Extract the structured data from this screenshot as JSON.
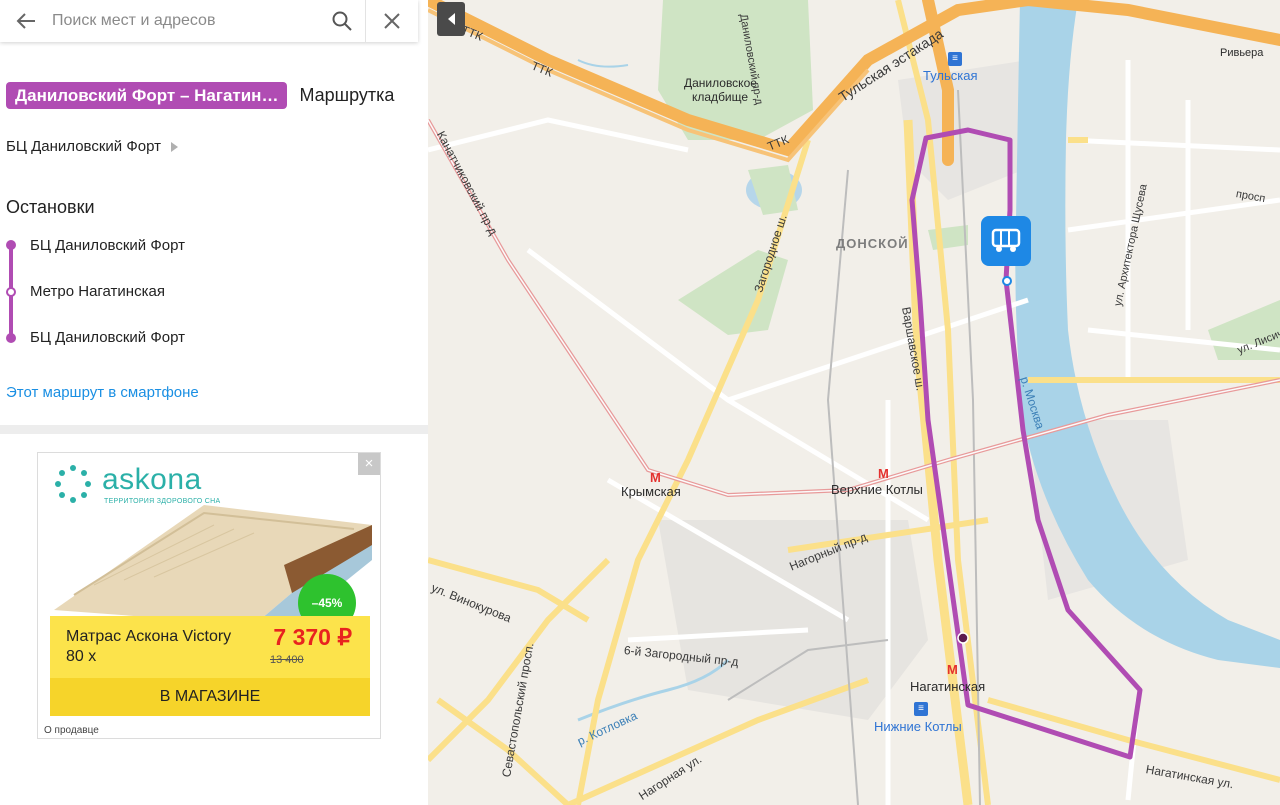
{
  "search": {
    "placeholder": "Поиск мест и адресов"
  },
  "route": {
    "name": "Даниловский Форт – Нагатин…",
    "type": "Маршрутка",
    "operator": "БЦ Даниловский Форт",
    "stops_title": "Остановки",
    "stops": [
      "БЦ Даниловский Форт",
      "Метро Нагатинская",
      "БЦ Даниловский Форт"
    ],
    "mobile_link": "Этот маршрут в смартфоне",
    "color": "#b04cb3"
  },
  "ad": {
    "brand": "askona",
    "tagline": "ТЕРРИТОРИЯ ЗДОРОВОГО СНА",
    "discount": "–45%",
    "product_line1": "Матрас Аскона Victory",
    "product_line2": "80 х",
    "price": "7 370 ₽",
    "old_price": "13 400",
    "cta": "В МАГАЗИНЕ",
    "seller": "О продавце"
  },
  "map": {
    "labels": {
      "ttk1": "ТТК",
      "ttk2": "ТТК",
      "ttk3": "ТТК",
      "tulskaya_estakada": "Тульская эстакада",
      "tulskaya": "Тульская",
      "danilovskoe": "Даниловское",
      "kladbishche": "кладбище",
      "riviera": "Ривьера",
      "donskoy": "ДОНСКОЙ",
      "zagorodnoe": "Загородное ш.",
      "kanatchikovsky": "Канатчиковский пр-д",
      "krymskaya": "Крымская",
      "verkhnie_kotly": "Верхние Котлы",
      "nagorny_prd": "Нагорный пр-д",
      "vinokurova": "ул. Винокурова",
      "zagorodny6": "6-й Загородный пр-д",
      "sevastopolsky": "Севастопольский просп.",
      "kotlovka": "р. Котловка",
      "nagornaya": "Нагорная ул.",
      "nagatinskaya_metro": "Нагатинская",
      "nizhnie_kotly": "Нижние Котлы",
      "nagatinskaya_ul": "Нагатинская ул.",
      "moskva_river": "р. Москва",
      "arkh_shuseva": "ул. Архитектора Щусева",
      "varshavskoe": "Варшавское ш.",
      "lisichkina": "ул. Лисич",
      "prosp": "просп",
      "danilovsky_prd": "Даниловский пр-д"
    }
  }
}
